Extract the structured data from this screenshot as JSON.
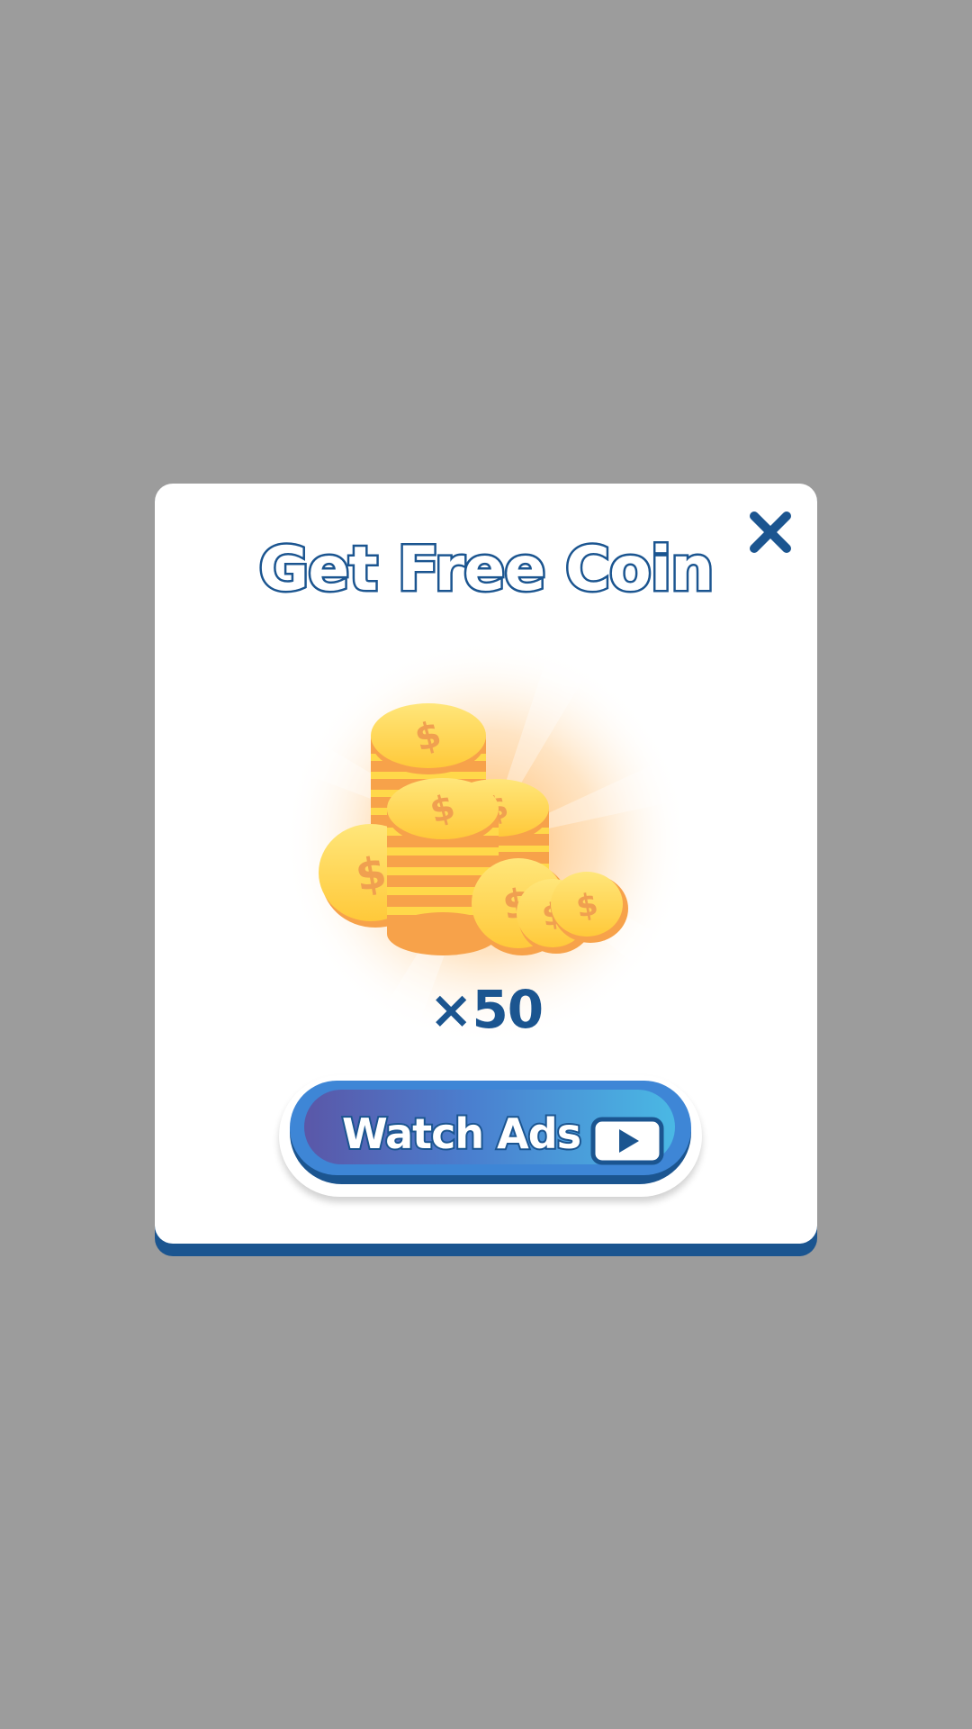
{
  "dialog": {
    "title": "Get Free Coin",
    "amount": "×50",
    "close_icon": "close-icon",
    "reward_icon": "coin-stack-icon",
    "watch_button": {
      "label": "Watch Ads",
      "icon": "play-icon"
    }
  },
  "colors": {
    "backdrop": "#9c9c9c",
    "panel": "#ffffff",
    "primary_dark": "#1b5590",
    "button_gradient_start": "#5a57a8",
    "button_gradient_end": "#4ab8e4",
    "coin_gold": "#ffd84a",
    "coin_shadow": "#f7a24a"
  }
}
